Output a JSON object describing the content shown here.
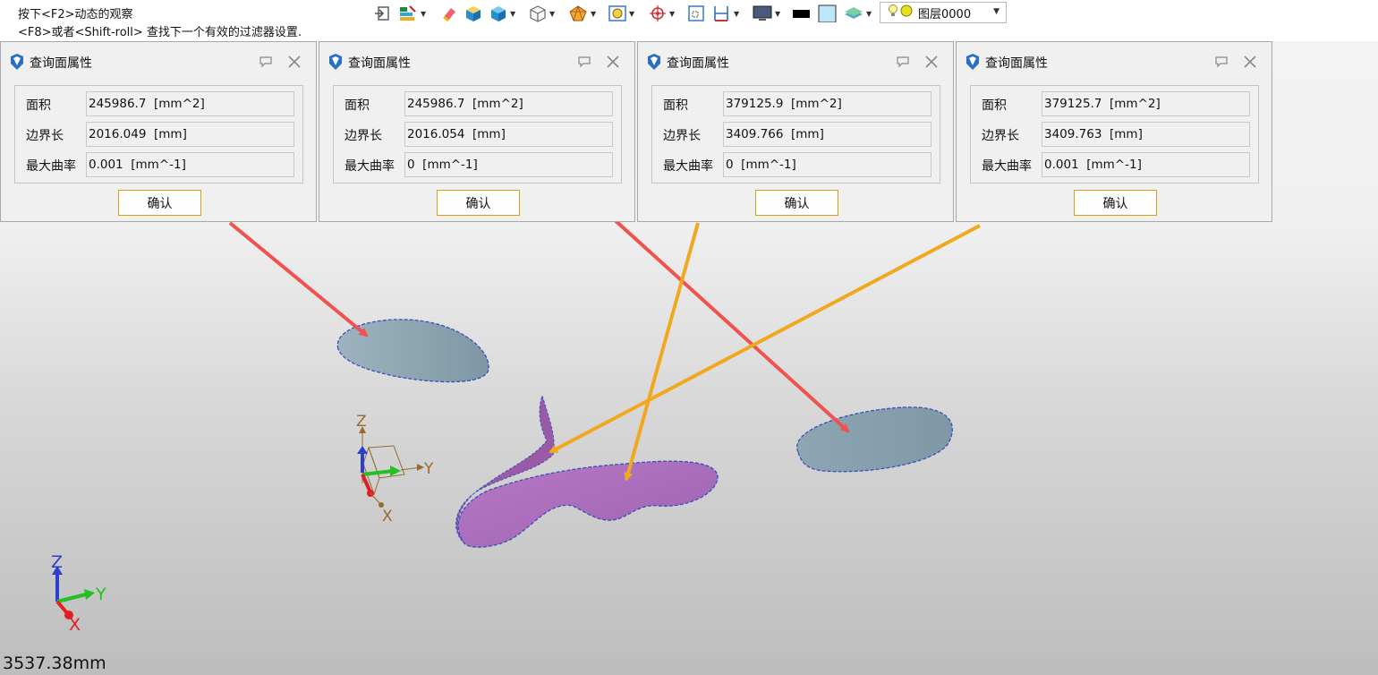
{
  "hints": {
    "line1": "按下<F2>动态的观察",
    "line2": "<F8>或者<Shift-roll> 查找下一个有效的过滤器设置."
  },
  "toolbar": {
    "layer_label": "图层0000",
    "icons": [
      "exit-icon",
      "layers-manager-icon",
      "eraser-icon",
      "shaded-cube-icon",
      "solid-cube-icon",
      "wireframe-cube-icon",
      "render-style-icon",
      "view-fit-icon",
      "snap-target-icon",
      "zoom-window-icon",
      "dimension-icon",
      "display-monitor-icon",
      "color-black-swatch",
      "color-light-swatch",
      "layer-stack-icon",
      "lightbulb-icon"
    ]
  },
  "colors": {
    "accent_button_border": "#d4a018",
    "red_arrow": "#f0524f",
    "orange_arrow": "#f0a81c",
    "blue_surface": "#8fa6b3",
    "purple_surface": "#b06fc0"
  },
  "panels": [
    {
      "title": "查询面属性",
      "rows": [
        {
          "label": "面积",
          "value": "245986.7  [mm^2]"
        },
        {
          "label": "边界长",
          "value": "2016.049  [mm]"
        },
        {
          "label": "最大曲率",
          "value": "0.001  [mm^-1]"
        }
      ],
      "ok": "确认"
    },
    {
      "title": "查询面属性",
      "rows": [
        {
          "label": "面积",
          "value": "245986.7  [mm^2]"
        },
        {
          "label": "边界长",
          "value": "2016.054  [mm]"
        },
        {
          "label": "最大曲率",
          "value": "0  [mm^-1]"
        }
      ],
      "ok": "确认"
    },
    {
      "title": "查询面属性",
      "rows": [
        {
          "label": "面积",
          "value": "379125.9  [mm^2]"
        },
        {
          "label": "边界长",
          "value": "3409.766  [mm]"
        },
        {
          "label": "最大曲率",
          "value": "0  [mm^-1]"
        }
      ],
      "ok": "确认"
    },
    {
      "title": "查询面属性",
      "rows": [
        {
          "label": "面积",
          "value": "379125.7  [mm^2]"
        },
        {
          "label": "边界长",
          "value": "3409.763  [mm]"
        },
        {
          "label": "最大曲率",
          "value": "0.001  [mm^-1]"
        }
      ],
      "ok": "确认"
    }
  ],
  "axes": {
    "z": "Z",
    "y": "Y",
    "x": "X"
  },
  "scale": "3537.38mm"
}
